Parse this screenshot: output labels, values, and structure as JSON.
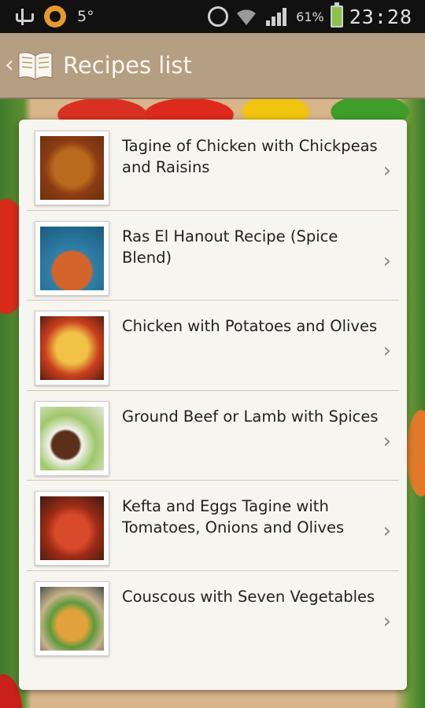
{
  "status_bar": {
    "temperature": "5°",
    "battery_percent": "61%",
    "time": "23:28",
    "icons": [
      "usb-icon",
      "app-notification-icon",
      "alarm-icon",
      "wifi-icon",
      "signal-icon",
      "battery-charging-icon"
    ]
  },
  "action_bar": {
    "back_icon": "chevron-left-icon",
    "app_icon": "open-book-icon",
    "title": "Recipes list"
  },
  "recipes": [
    {
      "title": "Tagine of Chicken with Chickpeas and Raisins",
      "thumb": "tagine-chicken-thumbnail"
    },
    {
      "title": "Ras El Hanout Recipe (Spice Blend)",
      "thumb": "ras-el-hanout-thumbnail"
    },
    {
      "title": "Chicken with Potatoes and Olives",
      "thumb": "chicken-potatoes-thumbnail"
    },
    {
      "title": "Ground Beef or Lamb with Spices",
      "thumb": "ground-beef-thumbnail"
    },
    {
      "title": "Kefta and Eggs Tagine with Tomatoes, Onions and Olives",
      "thumb": "kefta-eggs-thumbnail"
    },
    {
      "title": "Couscous with Seven Vegetables",
      "thumb": "couscous-thumbnail"
    }
  ]
}
